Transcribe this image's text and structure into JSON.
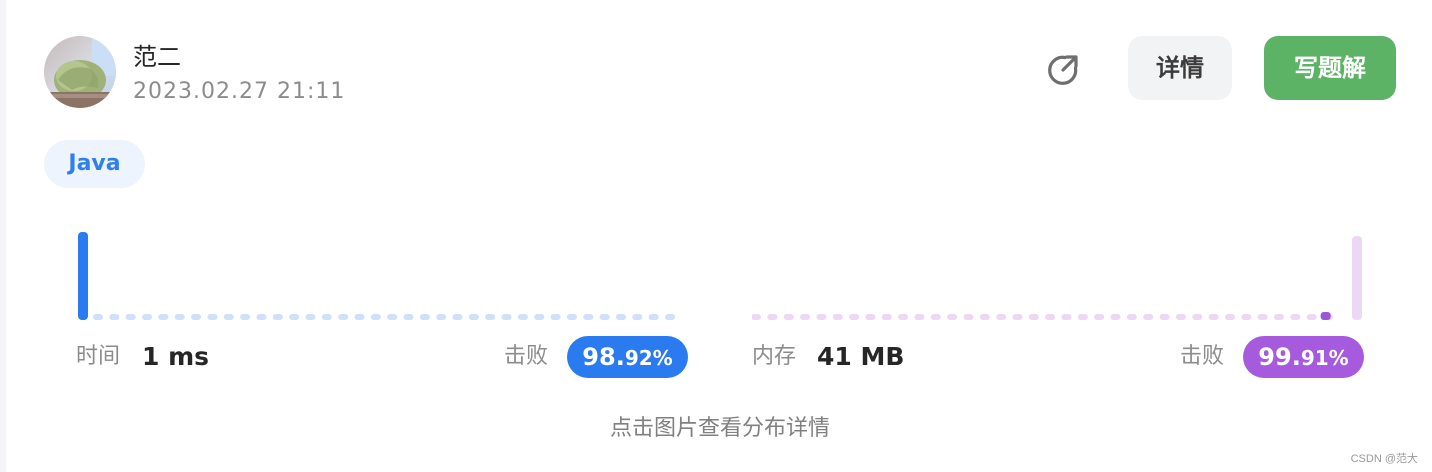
{
  "user": {
    "name": "范二",
    "timestamp": "2023.02.27 21:11"
  },
  "actions": {
    "share_icon": "share-arrow-icon",
    "details_label": "详情",
    "solution_label": "写题解"
  },
  "language": "Java",
  "runtime": {
    "label": "时间",
    "value": "1 ms",
    "beat_label": "击败",
    "beat_main": "98.",
    "beat_decimal": "92%",
    "beat_percent": 98.92
  },
  "memory": {
    "label": "内存",
    "value": "41 MB",
    "beat_label": "击败",
    "beat_main": "99.",
    "beat_decimal": "91%",
    "beat_percent": 99.91
  },
  "hint": "点击图片查看分布详情",
  "watermark": "CSDN @范大",
  "colors": {
    "accent_blue": "#2b7bf0",
    "accent_purple": "#a65bde",
    "solution_green": "#5cb365"
  }
}
